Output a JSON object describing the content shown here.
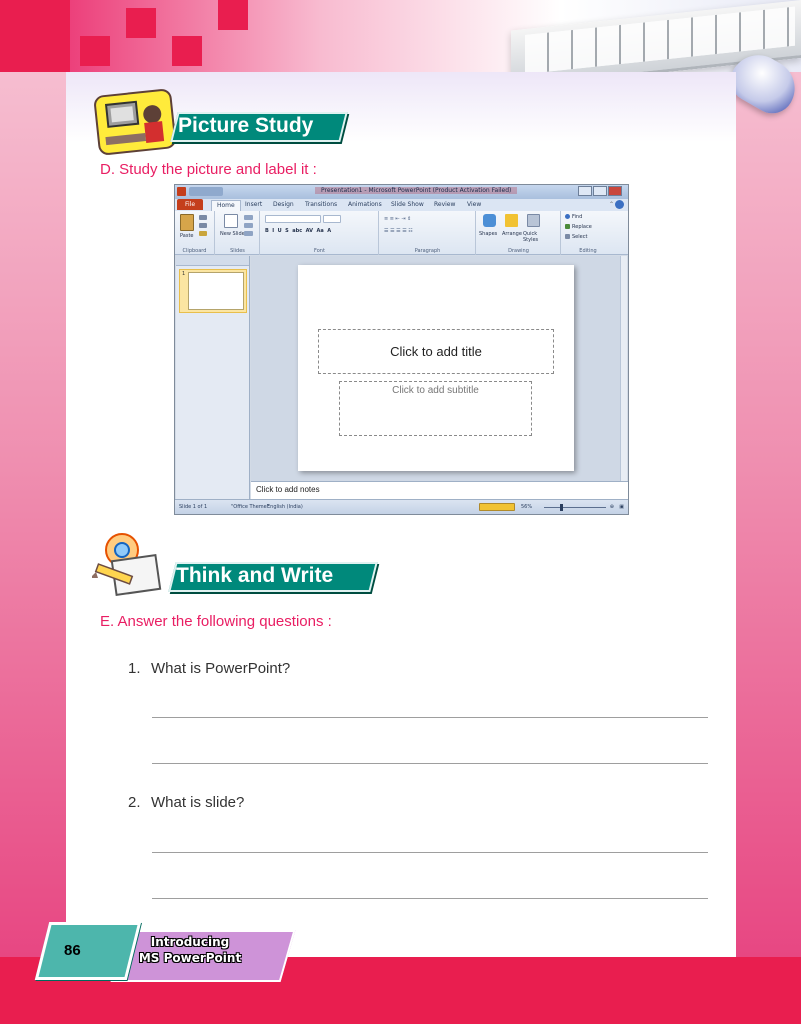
{
  "header": {
    "picture_study_title": "Picture Study",
    "think_write_title": "Think and Write"
  },
  "section_d": {
    "label": "D.  Study the picture and label it :"
  },
  "powerpoint_window": {
    "title": "Presentation1 - Microsoft PowerPoint (Product Activation Failed)",
    "tabs": [
      "File",
      "Home",
      "Insert",
      "Design",
      "Transitions",
      "Animations",
      "Slide Show",
      "Review",
      "View"
    ],
    "active_tab": "Home",
    "groups": [
      "Clipboard",
      "Slides",
      "Font",
      "Paragraph",
      "Drawing",
      "Editing"
    ],
    "buttons": {
      "paste": "Paste",
      "new_slide": "New Slide",
      "shapes": "Shapes",
      "arrange": "Arrange",
      "quick_styles": "Quick Styles",
      "find": "Find",
      "replace": "Replace",
      "select": "Select"
    },
    "slide_number": "1",
    "title_placeholder": "Click to add title",
    "subtitle_placeholder": "Click to add subtitle",
    "notes_placeholder": "Click to add notes",
    "status": {
      "slide": "Slide 1 of 1",
      "theme": "\"Office Theme\"",
      "language": "English (India)",
      "zoom": "56%",
      "zoom_fraction": 0.56
    }
  },
  "section_e": {
    "label": "E.  Answer the following questions :",
    "questions": [
      {
        "number": "1.",
        "text": "What is PowerPoint?"
      },
      {
        "number": "2.",
        "text": "What is slide?"
      }
    ]
  },
  "footer": {
    "page_number": "86",
    "chapter_title_line1": "Introducing",
    "chapter_title_line2": "MS PowerPoint"
  },
  "colors": {
    "accent_pink": "#e91e4f",
    "banner_teal": "#00897b",
    "question_pink": "#e91e63",
    "footer_purple": "#ce93d8"
  }
}
